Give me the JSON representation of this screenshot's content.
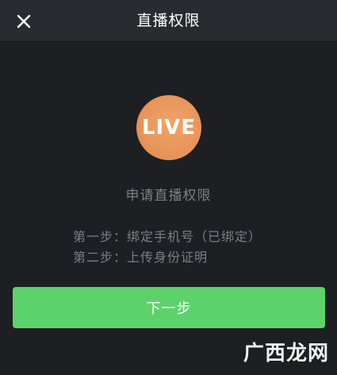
{
  "header": {
    "title": "直播权限",
    "close_icon": "close-icon"
  },
  "badge": {
    "label": "LIVE",
    "color": "#e79358"
  },
  "content": {
    "subtitle": "申请直播权限",
    "steps": [
      "第一步：绑定手机号（已绑定）",
      "第二步：上传身份证明"
    ]
  },
  "actions": {
    "next_label": "下一步",
    "button_color": "#5dd26b"
  },
  "watermark": {
    "text": "广西龙网"
  }
}
